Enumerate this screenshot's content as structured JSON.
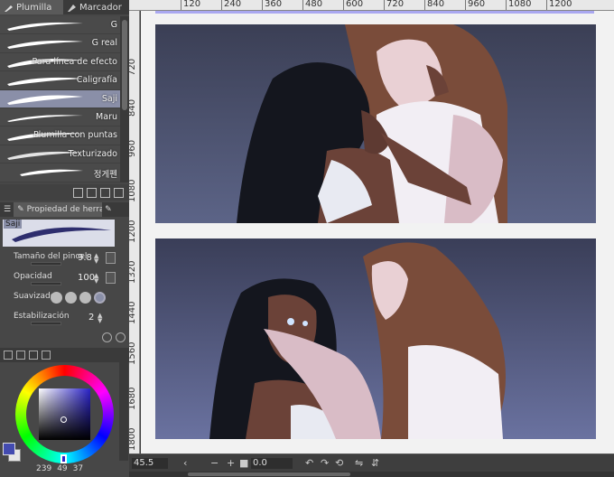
{
  "tool_tabs": [
    {
      "label": "Plumilla",
      "icon": "pen-icon"
    },
    {
      "label": "Marcador",
      "icon": "marker-icon"
    }
  ],
  "brushes": [
    {
      "label": "G"
    },
    {
      "label": "G real"
    },
    {
      "label": "Para línea de efecto"
    },
    {
      "label": "Caligrafía"
    },
    {
      "label": "Saji"
    },
    {
      "label": "Maru"
    },
    {
      "label": "Plumilla con puntas"
    },
    {
      "label": "Texturizado"
    },
    {
      "label": "정게펜"
    }
  ],
  "selected_brush": "Saji",
  "tool_property": {
    "tab_label": "Propiedad de herramienta",
    "preview_name": "Saji",
    "brush_size_label": "Tamaño del pincel",
    "brush_size_value": "9.8",
    "opacity_label": "Opacidad",
    "opacity_value": "100",
    "smoothing_label": "Suavizado",
    "stabilization_label": "Estabilización",
    "stabilization_value": "2"
  },
  "color": {
    "main": "#434bb0",
    "sub": "#e6e6e6",
    "hue_color": "#2b23c8",
    "values": [
      "239",
      "49",
      "37"
    ]
  },
  "ruler_top": [
    "120",
    "240",
    "360",
    "480",
    "600",
    "720",
    "840",
    "960",
    "1080",
    "1200"
  ],
  "ruler_left": [
    "720",
    "840",
    "960",
    "1080",
    "1200",
    "1320",
    "1440",
    "1560",
    "1680",
    "1800"
  ],
  "status": {
    "zoom": "45.5",
    "rotation": "0.0"
  }
}
